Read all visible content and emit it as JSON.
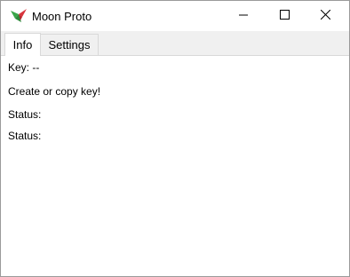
{
  "window": {
    "title": "Moon Proto",
    "app_icon": "moon-proto-app-icon",
    "controls": {
      "minimize_icon": "minimize-icon",
      "maximize_icon": "maximize-icon",
      "close_icon": "close-icon"
    }
  },
  "tabs": [
    {
      "label": "Info",
      "selected": true
    },
    {
      "label": "Settings",
      "selected": false
    }
  ],
  "info": {
    "key_line": "Key: --",
    "message": "Create or copy key!",
    "status_1": "Status:",
    "status_2": "Status:"
  },
  "colors": {
    "icon_green": "#3aa64a",
    "icon_red": "#d8343c"
  }
}
